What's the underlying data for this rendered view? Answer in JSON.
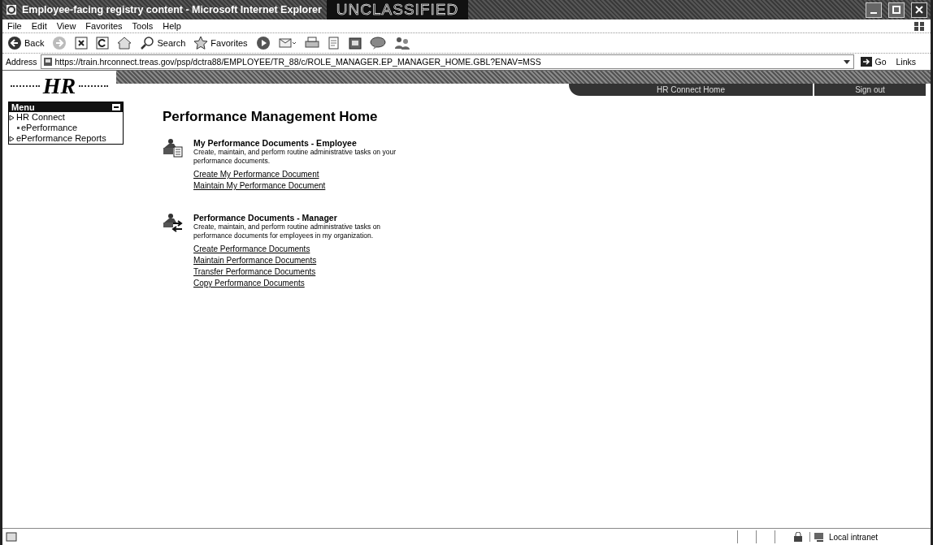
{
  "window": {
    "title": "Employee-facing registry content - Microsoft Internet Explorer",
    "banner": "UNCLASSIFIED"
  },
  "menu_bar": [
    "File",
    "Edit",
    "View",
    "Favorites",
    "Tools",
    "Help"
  ],
  "toolbar": [
    {
      "kind": "back",
      "label": "Back"
    },
    {
      "kind": "forward"
    },
    {
      "kind": "stop"
    },
    {
      "kind": "refresh"
    },
    {
      "kind": "home"
    },
    {
      "kind": "search",
      "label": "Search"
    },
    {
      "kind": "favorites",
      "label": "Favorites"
    },
    {
      "kind": "media"
    },
    {
      "kind": "mail"
    },
    {
      "kind": "print"
    },
    {
      "kind": "edit"
    },
    {
      "kind": "discuss"
    },
    {
      "kind": "messenger"
    },
    {
      "kind": "research"
    }
  ],
  "address": {
    "label": "Address",
    "value": "https://train.hrconnect.treas.gov/psp/dctra88/EMPLOYEE/TR_88/c/ROLE_MANAGER.EP_MANAGER_HOME.GBL?ENAV=MSS",
    "go": "Go",
    "links": "Links"
  },
  "header_links": [
    "HR Connect Home",
    "Sign out"
  ],
  "logo": {
    "text": "HR"
  },
  "side_menu": {
    "title": "Menu",
    "items": [
      {
        "kind": "folder",
        "label": "HR Connect",
        "children": [
          {
            "kind": "page",
            "label": "ePerformance"
          }
        ]
      },
      {
        "kind": "folder",
        "label": "ePerformance Reports"
      }
    ]
  },
  "heading": "Performance Management Home",
  "sections": [
    {
      "kind": "employee",
      "title": "My Performance Documents - Employee",
      "description": "Create, maintain, and perform routine administrative tasks on your performance documents.",
      "links": [
        "Create My Performance Document",
        "Maintain My Performance Document"
      ]
    },
    {
      "kind": "manager",
      "title": "Performance Documents - Manager",
      "description": "Create, maintain, and perform routine administrative tasks on performance documents for employees in my organization.",
      "links": [
        "Create Performance Documents",
        "Maintain Performance Documents",
        "Transfer Performance Documents",
        "Copy Performance Documents"
      ]
    }
  ],
  "status_bar": {
    "zone": "Local intranet"
  }
}
